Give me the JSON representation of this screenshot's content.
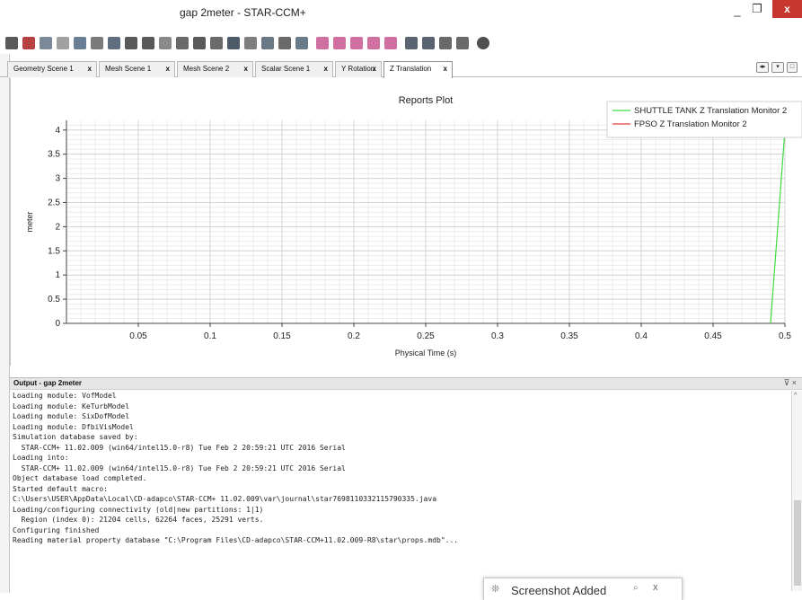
{
  "window": {
    "title": "gap 2meter - STAR-CCM+",
    "minimize": "_",
    "maximize": "❐",
    "close": "x"
  },
  "toolbar": {
    "icons": [
      "running-man-icon",
      "stop-icon",
      "screen-icon",
      "grid-icon",
      "mesh-icon",
      "shape-icon",
      "camera-icon",
      "arrow-left-icon",
      "arrow-right-icon",
      "object-icon",
      "node-icon",
      "bar-icon",
      "table-icon",
      "cube-icon",
      "scalar-icon",
      "view-icon",
      "cut-icon",
      "select-icon",
      "play-icon",
      "stop-run-icon",
      "step-back-icon",
      "step-forward-icon",
      "record-icon",
      "chart-icon",
      "monitor-icon",
      "plot-icon",
      "options-icon",
      "gear-icon"
    ]
  },
  "tabs": [
    {
      "label": "Geometry Scene 1"
    },
    {
      "label": "Mesh Scene 1"
    },
    {
      "label": "Mesh Scene 2"
    },
    {
      "label": "Scalar Scene 1"
    },
    {
      "label": "Y Rotation"
    },
    {
      "label": "Z Translation",
      "active": true
    }
  ],
  "tab_close": "x",
  "chart_data": {
    "type": "line",
    "title": "Reports Plot",
    "xlabel": "Physical Time (s)",
    "ylabel": "meter",
    "xlim": [
      0,
      0.5
    ],
    "ylim": [
      0,
      4.2
    ],
    "xticks": [
      0.05,
      0.1,
      0.15,
      0.2,
      0.25,
      0.3,
      0.35,
      0.4,
      0.45,
      0.5
    ],
    "xtick_labels": [
      "0.05",
      "0.1",
      "0.15",
      "0.2",
      "0.25",
      "0.3",
      "0.35",
      "0.4",
      "0.45",
      "0.5"
    ],
    "yticks": [
      0,
      0.5,
      1,
      1.5,
      2,
      2.5,
      3,
      3.5,
      4
    ],
    "ytick_labels": [
      "0",
      "0.5",
      "1",
      "1.5",
      "2",
      "2.5",
      "3",
      "3.5",
      "4"
    ],
    "grid": true,
    "legend_position": "top-right",
    "series": [
      {
        "name": "SHUTTLE TANK Z Translation Monitor 2",
        "color": "#3ddc3d",
        "x": [
          0.49,
          0.5
        ],
        "y": [
          0,
          4.0
        ]
      },
      {
        "name": "FPSO Z Translation Monitor 2",
        "color": "#e04040",
        "x": [],
        "y": []
      }
    ]
  },
  "output": {
    "title": "Output - gap 2meter",
    "pin": "⊽ ×",
    "lines": [
      "Loading module: VofModel",
      "Loading module: KeTurbModel",
      "Loading module: SixDofModel",
      "Loading module: DfbiVisModel",
      "Simulation database saved by:",
      "  STAR-CCM+ 11.02.009 (win64/intel15.0-r8) Tue Feb 2 20:59:21 UTC 2016 Serial",
      "Loading into:",
      "  STAR-CCM+ 11.02.009 (win64/intel15.0-r8) Tue Feb 2 20:59:21 UTC 2016 Serial",
      "Object database load completed.",
      "Started default macro:",
      "C:\\Users\\USER\\AppData\\Local\\CD-adapco\\STAR-CCM+ 11.02.009\\var\\journal\\star7698110332115790335.java",
      "Loading/configuring connectivity (old|new partitions: 1|1)",
      "  Region (index 0): 21204 cells, 62264 faces, 25291 verts.",
      "Configuring finished",
      "Reading material property database \"C:\\Program Files\\CD-adapco\\STAR-CCM+11.02.009-R8\\star\\props.mdb\"..."
    ]
  },
  "toast": {
    "icon": "❊",
    "text": "Screenshot Added",
    "search": "⌕",
    "close": "x"
  }
}
